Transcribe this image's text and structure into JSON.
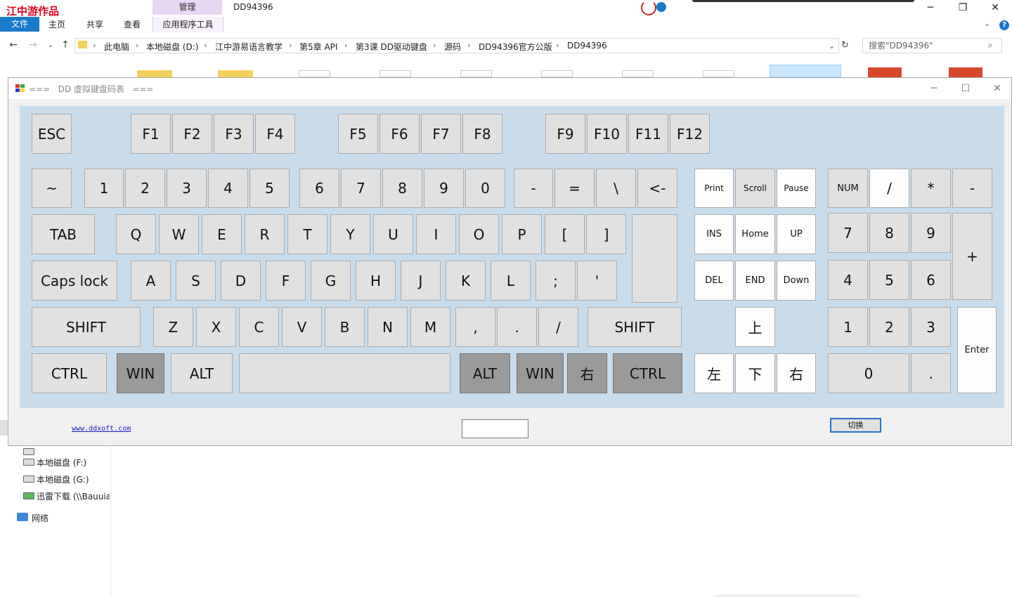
{
  "explorer": {
    "logo_text": "江中游作品",
    "context_tab_group": "管理",
    "context_tab": "应用程序工具",
    "window_title": "DD94396",
    "ribbon": {
      "file": "文件",
      "items": [
        "主页",
        "共享",
        "查看"
      ]
    },
    "breadcrumbs": [
      "此电脑",
      "本地磁盘 (D:)",
      "江中游易语言教学",
      "第5章 API",
      "第3课 DD驱动键盘",
      "源码",
      "DD94396官方公版",
      "DD94396"
    ],
    "search_placeholder": "搜索\"DD94396\"",
    "left_pane": {
      "drives": [
        "本地磁盘 (F:)",
        "本地磁盘 (G:)",
        "迅雷下载 (\\\\Bauuia"
      ],
      "network": "网络"
    }
  },
  "dialog": {
    "title": "===   DD 虚拟键盘码表   ===",
    "link": "www.ddxoft.com",
    "switch_label": "切换",
    "status_text": ""
  },
  "keys": {
    "esc": "ESC",
    "f": [
      "F1",
      "F2",
      "F3",
      "F4",
      "F5",
      "F6",
      "F7",
      "F8",
      "F9",
      "F10",
      "F11",
      "F12"
    ],
    "row1": [
      "~",
      "1",
      "2",
      "3",
      "4",
      "5",
      "6",
      "7",
      "8",
      "9",
      "0",
      "-",
      "=",
      "\\",
      "<-"
    ],
    "row2": [
      "TAB",
      "Q",
      "W",
      "E",
      "R",
      "T",
      "Y",
      "U",
      "I",
      "O",
      "P",
      "[",
      "]"
    ],
    "row3": [
      "Caps lock",
      "A",
      "S",
      "D",
      "F",
      "G",
      "H",
      "J",
      "K",
      "L",
      ";",
      "'"
    ],
    "row4": [
      "SHIFT",
      "Z",
      "X",
      "C",
      "V",
      "B",
      "N",
      "M",
      ",",
      ".",
      "/",
      "SHIFT"
    ],
    "row5": [
      "CTRL",
      "WIN",
      "ALT",
      "",
      "ALT",
      "WIN",
      "右",
      "CTRL"
    ],
    "nav": [
      "Print",
      "Scroll",
      "Pause",
      "INS",
      "Home",
      "UP",
      "DEL",
      "END",
      "Down"
    ],
    "arrows": [
      "上",
      "左",
      "下",
      "右"
    ],
    "numpad": [
      "NUM",
      "/",
      "*",
      "-",
      "7",
      "8",
      "9",
      "+",
      "4",
      "5",
      "6",
      "1",
      "2",
      "3",
      "Enter",
      "0",
      "."
    ]
  }
}
